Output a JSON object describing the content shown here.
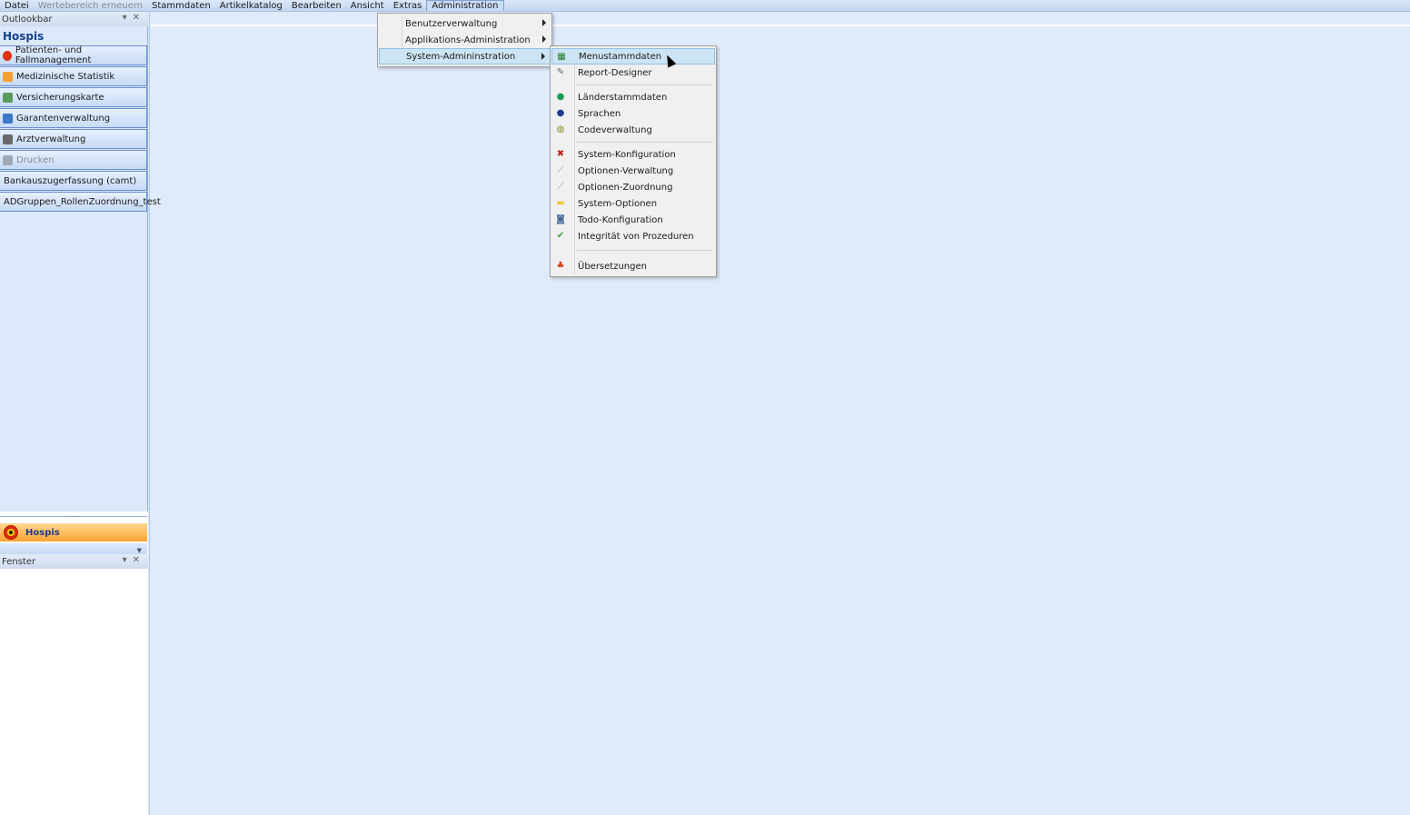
{
  "menubar": [
    "Datei",
    "Wertebereich erneuern",
    "Stammdaten",
    "Artikelkatalog",
    "Bearbeiten",
    "Ansicht",
    "Extras",
    "Administration"
  ],
  "outlookbar": {
    "title": "Outlookbar",
    "group_title": "Hospis",
    "items": [
      {
        "label": "Patienten- und Fallmanagement",
        "icon": "target-icon",
        "color": "#e03010"
      },
      {
        "label": "Medizinische Statistik",
        "icon": "chart-icon",
        "color": "#f5a030"
      },
      {
        "label": "Versicherungskarte",
        "icon": "card-icon",
        "color": "#5a9a5a"
      },
      {
        "label": "Garantenverwaltung",
        "icon": "user-icon",
        "color": "#3a78c8"
      },
      {
        "label": "Arztverwaltung",
        "icon": "doctor-icon",
        "color": "#6a6a6a"
      },
      {
        "label": "Drucken",
        "icon": "printer-icon",
        "color": "#a0a8b8"
      },
      {
        "label": "Bankauszugerfassung (camt)"
      },
      {
        "label": "ADGruppen_RollenZuordnung_test"
      }
    ],
    "active_group": "Hospis"
  },
  "fenster": {
    "title": "Fenster"
  },
  "admin_menu": [
    "Benutzerverwaltung",
    "Applikations-Administration",
    "System-Admininstration"
  ],
  "sys_menu": [
    {
      "label": "Menustammdaten",
      "icon": "tree-icon"
    },
    {
      "label": "Report-Designer",
      "icon": "edit-icon"
    },
    {
      "label": "Länderstammdaten",
      "icon": "globe-icon"
    },
    {
      "label": "Sprachen",
      "icon": "language-icon"
    },
    {
      "label": "Codeverwaltung",
      "icon": "code-icon"
    },
    {
      "label": "System-Konfiguration",
      "icon": "wrench-icon"
    },
    {
      "label": "Optionen-Verwaltung",
      "icon": "wrench-gray-icon"
    },
    {
      "label": "Optionen-Zuordnung",
      "icon": "wrench-gray-icon"
    },
    {
      "label": "System-Optionen",
      "icon": "folder-icon"
    },
    {
      "label": "Todo-Konfiguration",
      "icon": "todo-icon"
    },
    {
      "label": "Integrität von Prozeduren",
      "icon": "check-icon"
    },
    {
      "label": "Übersetzungen",
      "icon": "translate-icon"
    }
  ]
}
